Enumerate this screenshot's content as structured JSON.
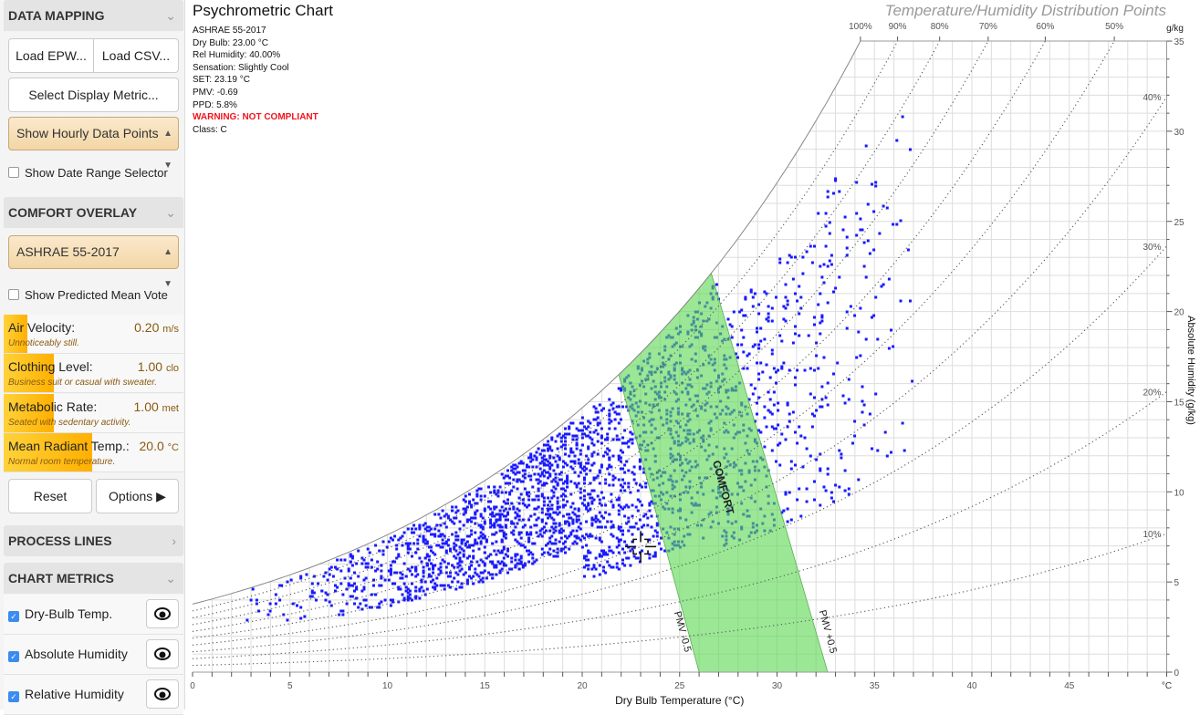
{
  "sidebar": {
    "data_mapping": {
      "title": "DATA MAPPING",
      "load_epw": "Load EPW...",
      "load_csv": "Load CSV...",
      "select_metric": "Select Display Metric...",
      "display_select": "Show Hourly Data Points",
      "date_range": "Show Date Range Selector",
      "date_range_checked": false
    },
    "comfort_overlay": {
      "title": "COMFORT OVERLAY",
      "model_select": "ASHRAE 55-2017",
      "pmv_toggle": "Show Predicted Mean Vote",
      "pmv_checked": false,
      "sliders": [
        {
          "label": "Air Velocity:",
          "value": "0.20",
          "unit": "m/s",
          "desc": "Unnoticeably still.",
          "level": 0.13
        },
        {
          "label": "Clothing Level:",
          "value": "1.00",
          "unit": "clo",
          "desc": "Business suit or casual with sweater.",
          "level": 0.28
        },
        {
          "label": "Metabolic Rate:",
          "value": "1.00",
          "unit": "met",
          "desc": "Seated with sedentary activity.",
          "level": 0.28
        },
        {
          "label": "Mean Radiant Temp.:",
          "value": "20.0",
          "unit": "°C",
          "desc": "Normal room temperature.",
          "level": 0.49
        }
      ],
      "reset": "Reset",
      "options": "Options"
    },
    "process_lines": {
      "title": "PROCESS LINES"
    },
    "chart_metrics": {
      "title": "CHART METRICS",
      "items": [
        {
          "label": "Dry-Bulb Temp.",
          "checked": true,
          "icon": "eye-icon"
        },
        {
          "label": "Absolute Humidity",
          "checked": true,
          "icon": "eye-icon"
        },
        {
          "label": "Relative Humidity",
          "checked": true,
          "icon": "eye-icon"
        }
      ]
    }
  },
  "info": {
    "title": "Psychrometric Chart",
    "subtitle": "Temperature/Humidity Distribution Points",
    "lines": [
      "ASHRAE 55-2017",
      "Dry Bulb: 23.00 °C",
      "Rel Humidity: 40.00%",
      "Sensation: Slightly Cool",
      "SET: 23.19 °C",
      "PMV: -0.69",
      "PPD: 5.8%"
    ],
    "warning": "WARNING: NOT COMPLIANT",
    "class": "Class: C"
  },
  "chart_data": {
    "type": "scatter",
    "xlabel": "Dry Bulb Temperature (°C)",
    "ylabel": "Absolute Humidity (g/kg)",
    "x_unit": "°C",
    "y_unit": "g/kg",
    "xlim": [
      0,
      50
    ],
    "ylim": [
      0,
      35
    ],
    "x_ticks": [
      "0",
      "5",
      "10",
      "15",
      "20",
      "25",
      "30",
      "35",
      "40",
      "45"
    ],
    "y_ticks": [
      "0",
      "5",
      "10",
      "15",
      "20",
      "25",
      "30",
      "35"
    ],
    "grid": true,
    "rh_lines": [
      {
        "label": "100%",
        "rh": 1.0
      },
      {
        "label": "90%",
        "rh": 0.9
      },
      {
        "label": "80%",
        "rh": 0.8
      },
      {
        "label": "70%",
        "rh": 0.7
      },
      {
        "label": "60%",
        "rh": 0.6
      },
      {
        "label": "50%",
        "rh": 0.5
      },
      {
        "label": "40%",
        "rh": 0.4
      },
      {
        "label": "30%",
        "rh": 0.3
      },
      {
        "label": "20%",
        "rh": 0.2
      },
      {
        "label": "10%",
        "rh": 0.1
      }
    ],
    "comfort_zone": {
      "label": "COMFORT",
      "color": "#5ed855",
      "lower": {
        "label": "PMV -0.5",
        "at_0_gkg": 26.0,
        "at_20_gkg": 21.0
      },
      "upper": {
        "label": "PMV +0.5",
        "at_0_gkg": 32.6,
        "at_20_gkg": 27.2
      }
    },
    "series": [
      {
        "name": "Show Hourly Data Points",
        "color": "#1a1aff"
      }
    ],
    "cursor": {
      "x": 23.0,
      "rh": 0.4
    }
  }
}
